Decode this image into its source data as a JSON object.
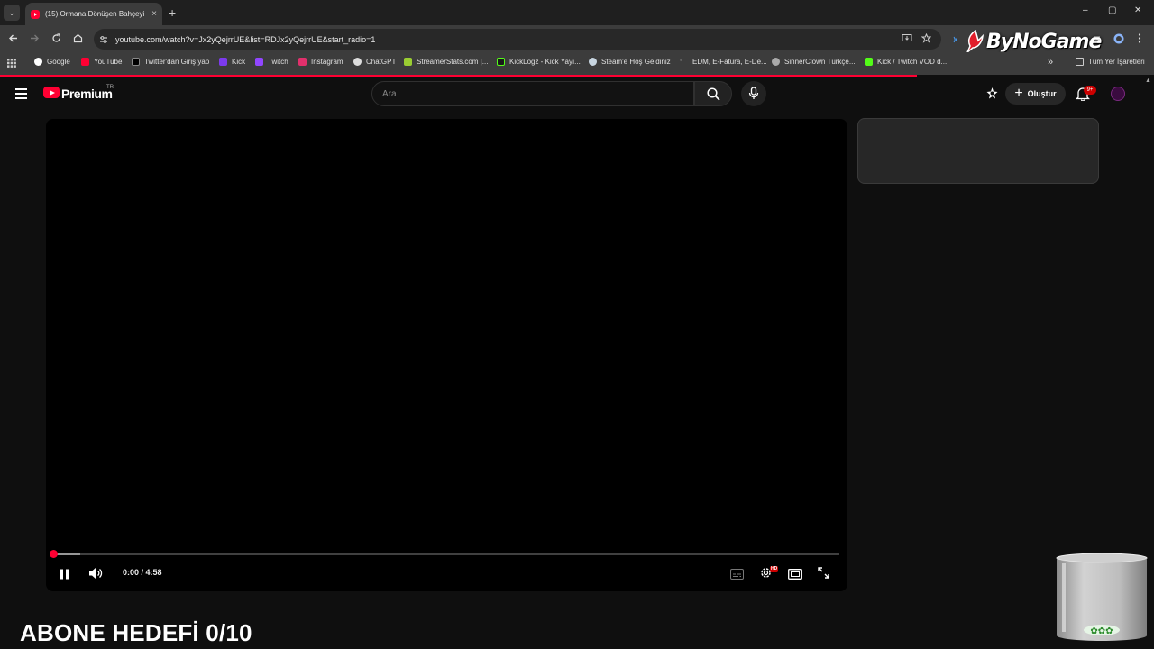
{
  "browser": {
    "tab": {
      "title": "(15) Ormana Dönüşen Bahçeyi"
    },
    "url": "youtube.com/watch?v=Jx2yQejrrUE&list=RDJx2yQejrrUE&start_radio=1",
    "new_tab_symbol": "+",
    "tab_close_symbol": "×",
    "window_controls": {
      "minimize": "–",
      "maximize": "▢",
      "close": "✕"
    },
    "brand_logo": "ByNoGame",
    "bookmarks": [
      {
        "label": "Google",
        "icon": "google-icon"
      },
      {
        "label": "YouTube",
        "icon": "youtube-icon"
      },
      {
        "label": "Twitter'dan Giriş yap",
        "icon": "x-icon"
      },
      {
        "label": "Kick",
        "icon": "kick-icon"
      },
      {
        "label": "Twitch",
        "icon": "twitch-icon"
      },
      {
        "label": "Instagram",
        "icon": "instagram-icon"
      },
      {
        "label": "ChatGPT",
        "icon": "chatgpt-icon"
      },
      {
        "label": "StreamerStats.com |...",
        "icon": "stats-icon"
      },
      {
        "label": "KickLogz - Kick Yayı...",
        "icon": "kicklogz-icon"
      },
      {
        "label": "Steam'e Hoş Geldiniz",
        "icon": "steam-icon"
      },
      {
        "label": "EDM, E-Fatura, E-De...",
        "icon": "edm-icon"
      },
      {
        "label": "SinnerClown Türkçe...",
        "icon": "globe-icon"
      },
      {
        "label": "Kick / Twitch VOD d...",
        "icon": "d-icon"
      }
    ],
    "bookmarks_overflow": "»",
    "all_bookmarks": "Tüm Yer İşaretleri"
  },
  "youtube": {
    "brand": "Premium",
    "country": "TR",
    "search_placeholder": "Ara",
    "create_label": "Oluştur",
    "notification_count": "9+"
  },
  "player": {
    "current_time": "0:00",
    "duration": "4:58",
    "time_text": "0:00 / 4:58",
    "progress_fraction": 0.0,
    "hd_badge": "HD"
  },
  "overlay": {
    "goal_text": "ABONE HEDEFİ 0/10"
  },
  "colors": {
    "accent": "#ff0033",
    "background": "#0f0f0f",
    "chrome_toolbar": "#3c3c3c"
  }
}
